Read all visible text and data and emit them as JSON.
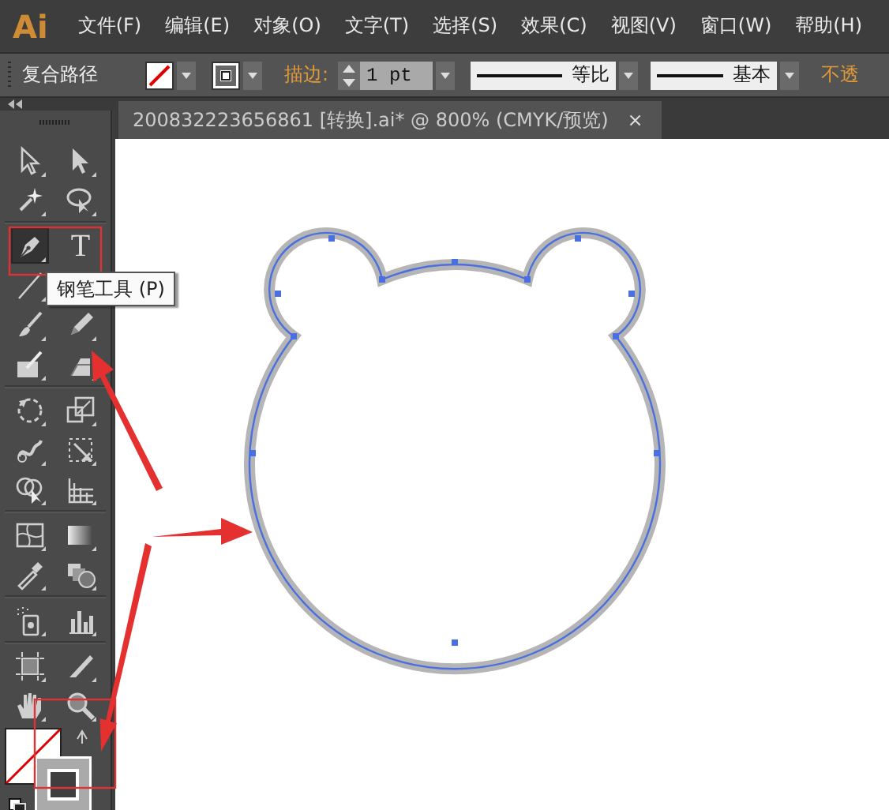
{
  "app": {
    "logo": "Ai"
  },
  "menu": [
    "文件(F)",
    "编辑(E)",
    "对象(O)",
    "文字(T)",
    "选择(S)",
    "效果(C)",
    "视图(V)",
    "窗口(W)",
    "帮助(H)"
  ],
  "control_bar": {
    "selection": "复合路径",
    "stroke_label": "描边:",
    "stroke_weight": "1 pt",
    "profile": "等比",
    "brush": "基本",
    "opacity_label": "不透"
  },
  "document_tab": {
    "title": "200832223656861  [转换].ai* @ 800% (CMYK/预览)",
    "close": "×"
  },
  "tools": [
    {
      "selected": false
    },
    {
      "selected": false
    },
    {
      "selected": false
    },
    {
      "selected": false
    },
    {
      "selected": true
    },
    {
      "selected": false,
      "glyph": "T"
    },
    {
      "selected": false
    },
    {
      "selected": false
    },
    {
      "selected": false
    },
    {
      "selected": false
    },
    {
      "selected": false
    },
    {
      "selected": false
    },
    {
      "selected": false
    },
    {
      "selected": false
    },
    {
      "selected": false
    },
    {
      "selected": false
    },
    {
      "selected": false
    },
    {
      "selected": false
    },
    {
      "selected": false
    },
    {
      "selected": false
    },
    {
      "selected": false
    },
    {
      "selected": false
    },
    {
      "selected": false
    },
    {
      "selected": false
    },
    {
      "selected": false
    },
    {
      "selected": false
    },
    {
      "selected": false
    }
  ],
  "tooltip": "钢笔工具 (P)"
}
